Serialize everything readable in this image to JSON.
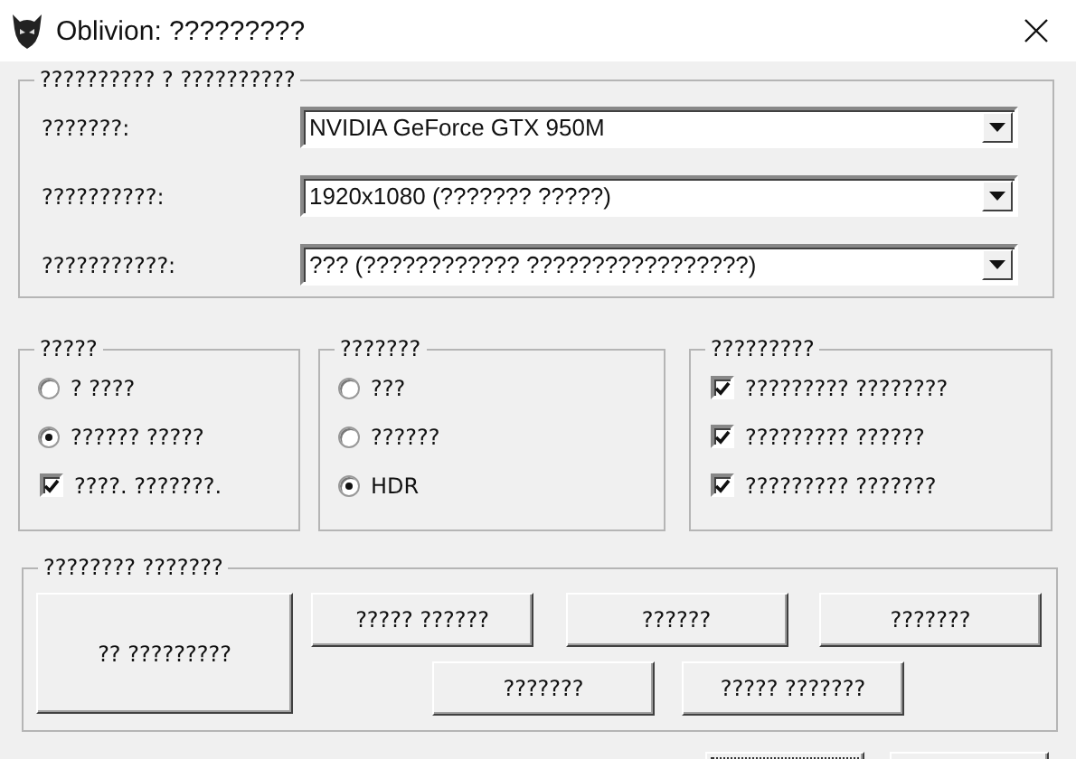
{
  "window": {
    "title": "Oblivion: ?????????"
  },
  "adapter_group": {
    "title": "?????????? ? ??????????",
    "fields": [
      {
        "label": "???????:",
        "value": "NVIDIA GeForce GTX 950M"
      },
      {
        "label": "??????????:",
        "value": "1920x1080 (??????? ?????)"
      },
      {
        "label": "???????????:",
        "value": "??? (???????????? ?????????????????)"
      }
    ]
  },
  "option_groups": [
    {
      "title": "?????",
      "options": [
        {
          "kind": "radio",
          "label": "? ????",
          "selected": false
        },
        {
          "kind": "radio",
          "label": "?????? ?????",
          "selected": true
        },
        {
          "kind": "checkbox",
          "label": "????. ???????.",
          "checked": true
        }
      ]
    },
    {
      "title": "???????",
      "options": [
        {
          "kind": "radio",
          "label": "???",
          "selected": false
        },
        {
          "kind": "radio",
          "label": "??????",
          "selected": false
        },
        {
          "kind": "radio",
          "label": "HDR",
          "selected": true
        }
      ]
    },
    {
      "title": "?????????",
      "options": [
        {
          "kind": "checkbox",
          "label": "????????? ????????",
          "checked": true
        },
        {
          "kind": "checkbox",
          "label": "????????? ??????",
          "checked": true
        },
        {
          "kind": "checkbox",
          "label": "????????? ???????",
          "checked": true
        }
      ]
    }
  ],
  "launch_group": {
    "title": "???????? ???????",
    "buttons": [
      {
        "kind": "primary",
        "label": "?? ?????????"
      },
      {
        "kind": "small",
        "label": "????? ??????"
      },
      {
        "kind": "small",
        "label": "??????"
      },
      {
        "kind": "small",
        "label": "???????"
      },
      {
        "kind": "small",
        "label": "???????"
      },
      {
        "kind": "small",
        "label": "????? ???????"
      }
    ]
  }
}
